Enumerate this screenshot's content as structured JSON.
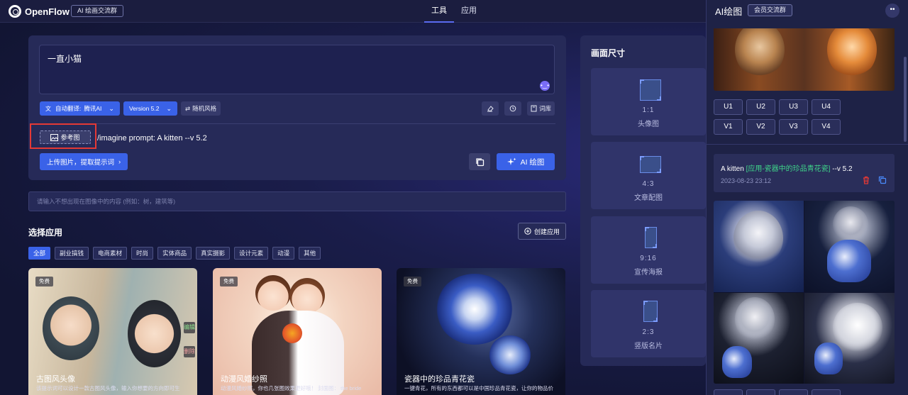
{
  "header": {
    "logo_text": "OpenFlow",
    "group_button": "AI 绘画交流群",
    "nav": [
      {
        "label": "工具",
        "active": true
      },
      {
        "label": "应用",
        "active": false
      }
    ]
  },
  "prompt": {
    "text": "一直小猫",
    "translate_label": "自动翻译:",
    "translate_engine": "腾讯AI",
    "version": "Version 5.2",
    "random_style": "随机风格",
    "lexicon": "词库",
    "reference_image": "参考图",
    "imagine_prompt": "/imagine prompt:  A kitten --v 5.2",
    "upload_button": "上传图片，提取提示词",
    "ai_draw_button": "AI 绘图"
  },
  "negative_prompt": {
    "placeholder": "请输入不想出现在图像中的内容 (例如：树，建筑等)"
  },
  "apps": {
    "title": "选择应用",
    "create_button": "创建应用",
    "categories": [
      {
        "label": "全部",
        "active": true
      },
      {
        "label": "副业搞钱",
        "active": false
      },
      {
        "label": "电商素材",
        "active": false
      },
      {
        "label": "时尚",
        "active": false
      },
      {
        "label": "实体商品",
        "active": false
      },
      {
        "label": "真实摄影",
        "active": false
      },
      {
        "label": "设计元素",
        "active": false
      },
      {
        "label": "动漫",
        "active": false
      },
      {
        "label": "其他",
        "active": false
      }
    ],
    "cards": [
      {
        "badge": "免费",
        "name": "古图风头像",
        "desc": "该提示词可以设计一款古图风头像，输入你想要的方向即可生",
        "edit": "编辑",
        "delete": "删除"
      },
      {
        "badge": "免费",
        "name": "动漫风婚纱照",
        "desc": "动漫风婚纱照，你也几张图效果更好哦！ 封面图： the bride"
      },
      {
        "badge": "免费",
        "name": "瓷器中的珍品青花瓷",
        "desc": "一键青花，所有的东西都可以是中国珍品青花瓷，让你的物品价"
      }
    ]
  },
  "size_panel": {
    "title": "画面尺寸",
    "options": [
      {
        "ratio": "1:1",
        "name": "头像图"
      },
      {
        "ratio": "4:3",
        "name": "文章配图"
      },
      {
        "ratio": "9:16",
        "name": "宣传海报"
      },
      {
        "ratio": "2:3",
        "name": "竖版名片"
      }
    ]
  },
  "drawer": {
    "title": "AI绘图",
    "member_button": "会员交流群",
    "u_buttons": [
      "U1",
      "U2",
      "U3",
      "U4"
    ],
    "v_buttons": [
      "V1",
      "V2",
      "V3",
      "V4"
    ],
    "job": {
      "prompt_prefix": "A kitten ",
      "prompt_highlight": "[应用-瓷器中的珍品青花瓷]",
      "prompt_suffix": " --v 5.2",
      "time": "2023-08-23 23:12"
    }
  },
  "colors": {
    "accent": "#3a62e8",
    "highlight_green": "#3fd58a",
    "danger": "#e53935"
  }
}
